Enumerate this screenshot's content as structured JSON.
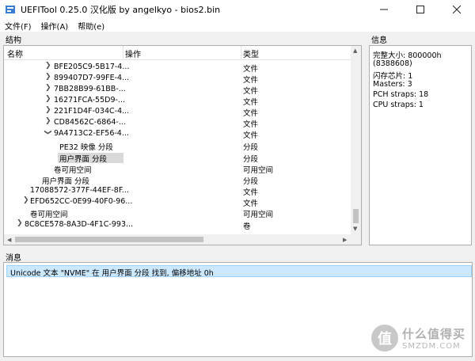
{
  "window": {
    "title": "UEFITool 0.25.0 汉化版 by angelkyo - bios2.bin"
  },
  "menu": {
    "file": "文件(F)",
    "action": "操作(A)",
    "help": "帮助(e)"
  },
  "structure": {
    "label": "结构",
    "columns": {
      "name": "名称",
      "action": "操作",
      "type": "类型"
    },
    "rows": [
      {
        "name": "BFE205C9-5B17-4...",
        "type": "文件"
      },
      {
        "name": "899407D7-99FE-4...",
        "type": "文件"
      },
      {
        "name": "7BB28B99-61BB-...",
        "type": "文件"
      },
      {
        "name": "16271FCA-55D9-...",
        "type": "文件"
      },
      {
        "name": "221F1D4F-034C-4...",
        "type": "文件"
      },
      {
        "name": "CD84562C-6864-...",
        "type": "文件"
      },
      {
        "name": "9A4713C2-EF56-4...",
        "type": "文件"
      },
      {
        "name": "PE32 映像 分段",
        "type": "分段"
      },
      {
        "name": "用户界面 分段",
        "type": "分段"
      },
      {
        "name": "卷可用空间",
        "type": "可用空间"
      },
      {
        "name": "用户界面 分段",
        "type": "分段"
      },
      {
        "name": "17088572-377F-44EF-8F...",
        "type": "文件"
      },
      {
        "name": "EFD652CC-0E99-40F0-96...",
        "type": "文件"
      },
      {
        "name": "卷可用空间",
        "type": "可用空间"
      },
      {
        "name": "8C8CE578-8A3D-4F1C-993...",
        "type": "卷"
      }
    ]
  },
  "info": {
    "label": "信息",
    "lines": [
      "完整大小: 800000h",
      "(8388608)",
      "闪存芯片: 1",
      "Masters: 3",
      "PCH straps: 18",
      "CPU straps: 1"
    ]
  },
  "messages": {
    "label": "消息",
    "items": [
      "Unicode 文本 \"NVME\" 在 用户界面 分段 找到, 偏移地址 0h"
    ]
  },
  "watermark": {
    "logo": "值",
    "main": "什么值得买",
    "sub": "SMZDM.COM"
  },
  "colors": {
    "selection": "#cce8ff",
    "selected_tree_row": "#d9d9d9"
  }
}
